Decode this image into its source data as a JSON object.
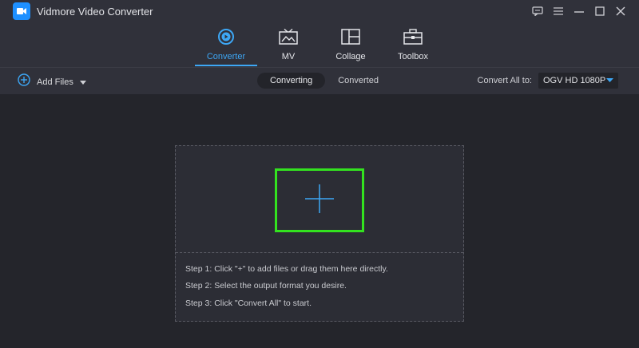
{
  "app": {
    "title": "Vidmore Video Converter"
  },
  "tabs": [
    {
      "label": "Converter",
      "icon": "converter-icon",
      "active": true
    },
    {
      "label": "MV",
      "icon": "mv-icon",
      "active": false
    },
    {
      "label": "Collage",
      "icon": "collage-icon",
      "active": false
    },
    {
      "label": "Toolbox",
      "icon": "toolbox-icon",
      "active": false
    }
  ],
  "toolbar": {
    "add_files_label": "Add Files",
    "segment": {
      "converting": "Converting",
      "converted": "Converted"
    },
    "convert_all_label": "Convert All to:",
    "format_value": "OGV HD 1080P"
  },
  "drop": {
    "steps": [
      "Step 1: Click \"+\" to add files or drag them here directly.",
      "Step 2: Select the output format you desire.",
      "Step 3: Click \"Convert All\" to start."
    ]
  },
  "colors": {
    "accent": "#3da7f5",
    "highlight": "#33e21f"
  }
}
